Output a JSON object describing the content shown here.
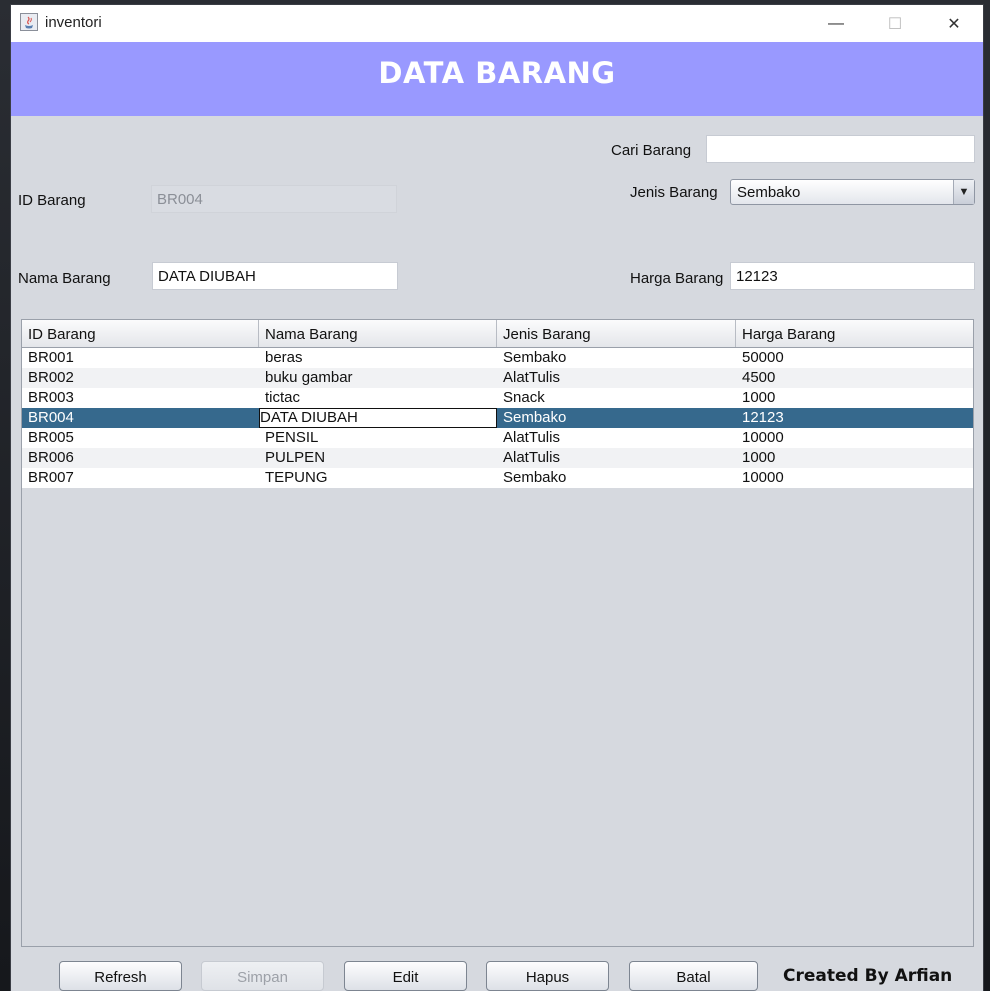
{
  "window": {
    "title": "inventori",
    "minimize_glyph": "—",
    "maximize_glyph": "☐",
    "close_glyph": "✕"
  },
  "header": {
    "title": "DATA BARANG"
  },
  "form": {
    "cari_label": "Cari Barang",
    "cari_value": "",
    "id_label": "ID Barang",
    "id_value": "BR004",
    "jenis_label": "Jenis Barang",
    "jenis_value": "Sembako",
    "nama_label": "Nama Barang",
    "nama_value": "DATA DIUBAH",
    "harga_label": "Harga Barang",
    "harga_value": "12123"
  },
  "table": {
    "columns": [
      "ID Barang",
      "Nama Barang",
      "Jenis Barang",
      "Harga Barang"
    ],
    "rows": [
      [
        "BR001",
        "beras",
        "Sembako",
        "50000"
      ],
      [
        "BR002",
        "buku gambar",
        "AlatTulis",
        "4500"
      ],
      [
        "BR003",
        "tictac",
        "Snack",
        "1000"
      ],
      [
        "BR004",
        "DATA DIUBAH",
        "Sembako",
        "12123"
      ],
      [
        "BR005",
        "PENSIL",
        "AlatTulis",
        "10000"
      ],
      [
        "BR006",
        "PULPEN",
        "AlatTulis",
        "1000"
      ],
      [
        "BR007",
        "TEPUNG",
        "Sembako",
        "10000"
      ]
    ],
    "selected_row_index": 3
  },
  "buttons": {
    "refresh": "Refresh",
    "simpan": "Simpan",
    "edit": "Edit",
    "hapus": "Hapus",
    "batal": "Batal"
  },
  "footer": {
    "credit": "Created By Arfian"
  },
  "colors": {
    "header_bg": "#9999ff",
    "selected_row": "#36698d",
    "panel_bg": "#d6d9df"
  }
}
